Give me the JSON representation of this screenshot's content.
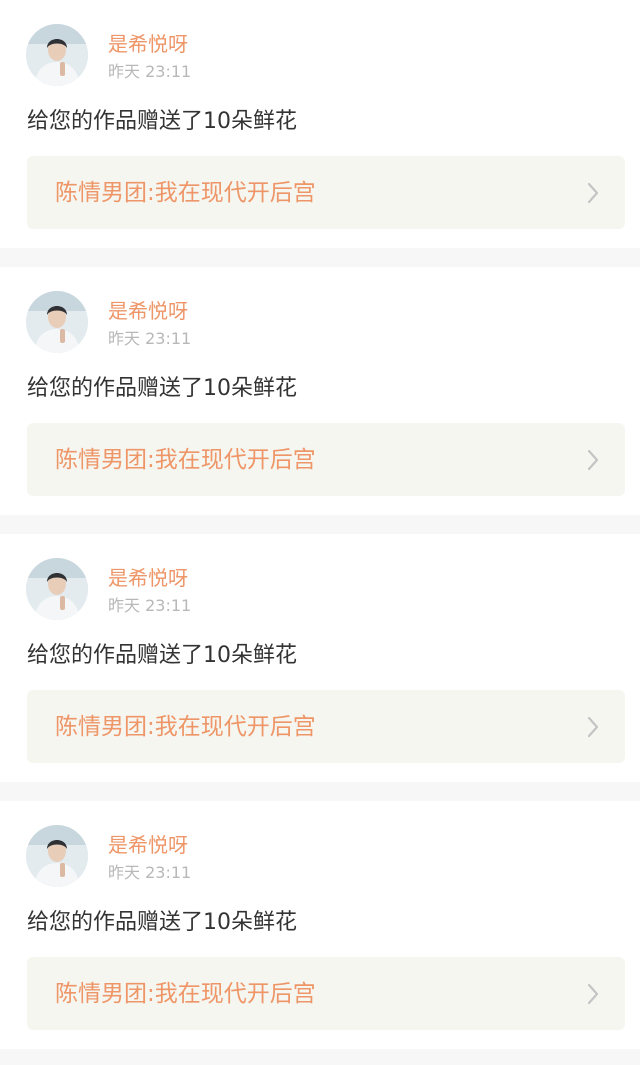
{
  "theme": {
    "accent": "#ee9667",
    "text": "#333333",
    "muted": "#b8b8b8",
    "card_bg": "#ffffff",
    "link_bg": "#f6f6f1",
    "page_bg": "#f7f7f7"
  },
  "notifications": [
    {
      "user": {
        "name": "是希悦呀",
        "avatar": "user-avatar-photo"
      },
      "time": "昨天 23:11",
      "message": "给您的作品赠送了10朵鲜花",
      "work": {
        "title": "陈情男团:我在现代开后宫",
        "icon": "chevron-right-icon"
      }
    },
    {
      "user": {
        "name": "是希悦呀",
        "avatar": "user-avatar-photo"
      },
      "time": "昨天 23:11",
      "message": "给您的作品赠送了10朵鲜花",
      "work": {
        "title": "陈情男团:我在现代开后宫",
        "icon": "chevron-right-icon"
      }
    },
    {
      "user": {
        "name": "是希悦呀",
        "avatar": "user-avatar-photo"
      },
      "time": "昨天 23:11",
      "message": "给您的作品赠送了10朵鲜花",
      "work": {
        "title": "陈情男团:我在现代开后宫",
        "icon": "chevron-right-icon"
      }
    },
    {
      "user": {
        "name": "是希悦呀",
        "avatar": "user-avatar-photo"
      },
      "time": "昨天 23:11",
      "message": "给您的作品赠送了10朵鲜花",
      "work": {
        "title": "陈情男团:我在现代开后宫",
        "icon": "chevron-right-icon"
      }
    }
  ]
}
